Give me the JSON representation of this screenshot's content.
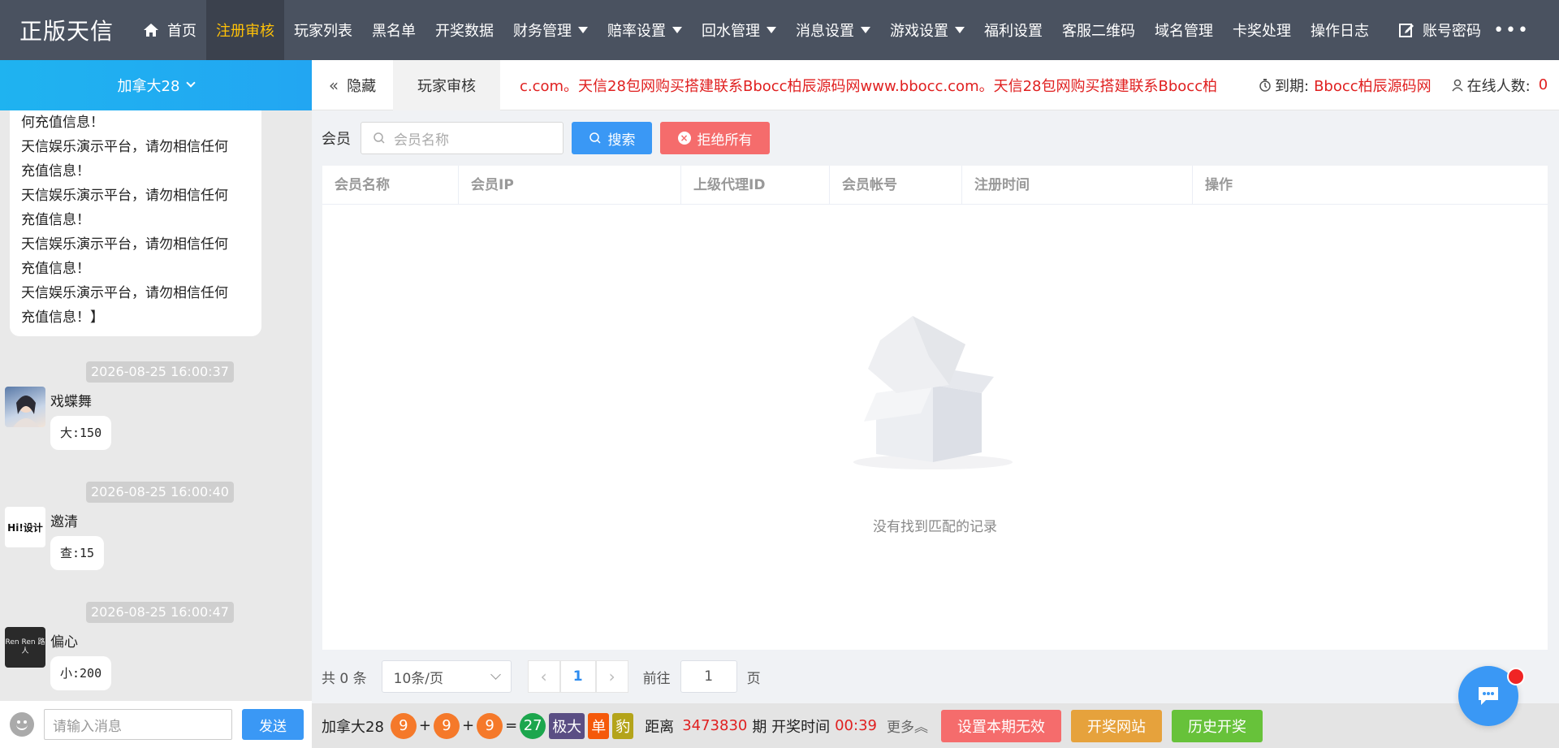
{
  "brand": "正版天信",
  "nav": {
    "items": [
      {
        "label": "首页"
      },
      {
        "label": "注册审核"
      },
      {
        "label": "玩家列表"
      },
      {
        "label": "黑名单"
      },
      {
        "label": "开奖数据"
      },
      {
        "label": "财务管理"
      },
      {
        "label": "赔率设置"
      },
      {
        "label": "回水管理"
      },
      {
        "label": "消息设置"
      },
      {
        "label": "游戏设置"
      },
      {
        "label": "福利设置"
      },
      {
        "label": "客服二维码"
      },
      {
        "label": "域名管理"
      },
      {
        "label": "卡奖处理"
      },
      {
        "label": "操作日志"
      },
      {
        "label": "账号密码"
      }
    ],
    "more": "•••",
    "accent": "#ffc107"
  },
  "left": {
    "game_selector": "加拿大28",
    "announcement_lines": [
      "何充值信息！",
      "天信娱乐演示平台，请勿相信任何",
      "充值信息！",
      "天信娱乐演示平台，请勿相信任何",
      "充值信息！",
      "天信娱乐演示平台，请勿相信任何",
      "充值信息！",
      "天信娱乐演示平台，请勿相信任何",
      "充值信息！】"
    ],
    "messages": [
      {
        "time": "2026-08-25 16:00:37",
        "user": "戏蝶舞",
        "text": "大:150"
      },
      {
        "time": "2026-08-25 16:00:40",
        "user": "邀清",
        "text": "查:15",
        "avatar_text": "Hi!设计"
      },
      {
        "time": "2026-08-25 16:00:47",
        "user": "偏心",
        "text": "小:200",
        "avatar_text": "Ren Ren 路人"
      }
    ],
    "input_placeholder": "请输入消息",
    "send_label": "发送"
  },
  "subbar": {
    "hide_label": "隐藏",
    "tab_label": "玩家审核",
    "marquee": "c.com。天信28包网购买搭建联系Bbocc柏辰源码网www.bbocc.com。天信28包网购买搭建联系Bbocc柏辰源码",
    "expire_label": "到期:",
    "expire_value": "Bbocc柏辰源码网",
    "online_label": "在线人数:",
    "online_value": "0"
  },
  "search": {
    "label": "会员",
    "placeholder": "会员名称",
    "search_btn": "搜索",
    "reject_btn": "拒绝所有"
  },
  "table": {
    "columns": [
      "会员名称",
      "会员IP",
      "上级代理ID",
      "会员帐号",
      "注册时间",
      "操作"
    ],
    "empty_text": "没有找到匹配的记录"
  },
  "pager": {
    "total": "共 0 条",
    "page_size": "10条/页",
    "current_page": "1",
    "goto_label": "前往",
    "goto_value": "1",
    "page_suffix": "页"
  },
  "bottom": {
    "game": "加拿大28",
    "balls": [
      "9",
      "9",
      "9"
    ],
    "plus": "+",
    "equals": "=",
    "sum": "27",
    "tags": [
      "极大",
      "单",
      "豹"
    ],
    "distance_label": "距离",
    "issue": "3473830",
    "issue_label": "期 开奖时间",
    "countdown": "00:39",
    "more": "更多",
    "btn_invalid": "设置本期无效",
    "btn_site": "开奖网站",
    "btn_history": "历史开奖"
  }
}
